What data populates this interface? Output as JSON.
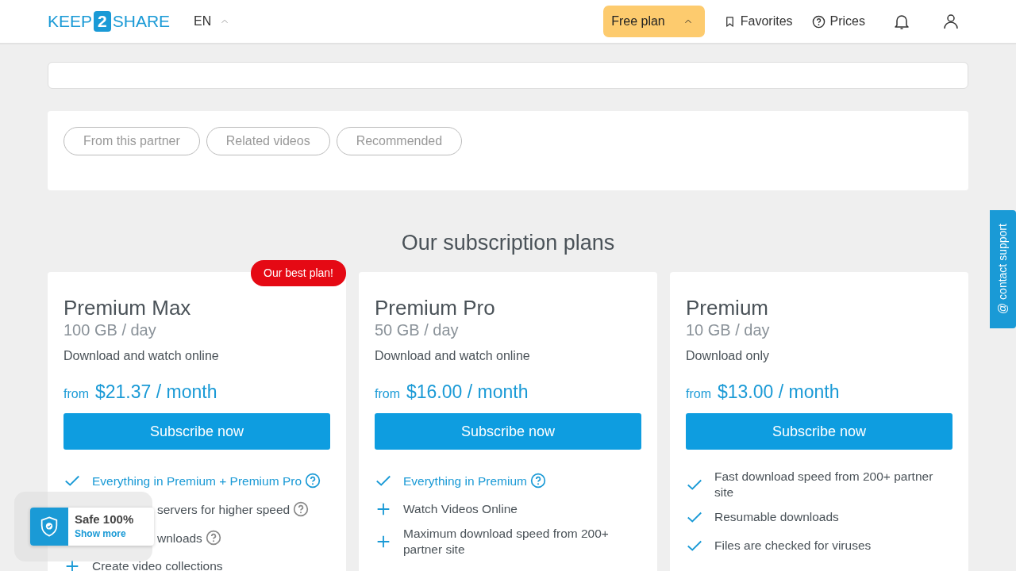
{
  "header": {
    "logo": {
      "left": "KEEP",
      "badge": "2",
      "right": "SHARE"
    },
    "language": "EN",
    "plan_button": "Free plan",
    "nav": [
      {
        "label": "Favorites"
      },
      {
        "label": "Prices"
      }
    ]
  },
  "tabs": [
    {
      "label": "From this partner",
      "selected": false
    },
    {
      "label": "Related videos",
      "selected": false
    },
    {
      "label": "Recommended",
      "selected": false
    }
  ],
  "plans_title": "Our subscription plans",
  "plans": [
    {
      "badge": "Our best plan!",
      "name": "Premium Max",
      "quota": "100 GB / day",
      "description": "Download and watch online",
      "from": "from",
      "price": "$21.37 / month",
      "button": "Subscribe now",
      "features": [
        {
          "kind": "check",
          "text": "Everything in Premium + Premium Pro",
          "emphasis": true,
          "help": true
        },
        {
          "kind": "covered",
          "text": "servers for higher speed",
          "emphasis": false,
          "help": true
        },
        {
          "kind": "covered",
          "text": "wnloads",
          "emphasis": false,
          "help": true
        },
        {
          "kind": "plus",
          "text": "Create video collections",
          "emphasis": false,
          "help": false
        }
      ]
    },
    {
      "name": "Premium Pro",
      "quota": "50 GB / day",
      "description": "Download and watch online",
      "from": "from",
      "price": "$16.00 / month",
      "button": "Subscribe now",
      "features": [
        {
          "kind": "check",
          "text": "Everything in Premium",
          "emphasis": true,
          "help": true
        },
        {
          "kind": "plus",
          "text": "Watch Videos Online",
          "emphasis": false,
          "help": false
        },
        {
          "kind": "plus",
          "text": "Maximum download speed from 200+ partner site",
          "emphasis": false,
          "help": false
        }
      ]
    },
    {
      "name": "Premium",
      "quota": "10 GB / day",
      "description": "Download only",
      "from": "from",
      "price": "$13.00 / month",
      "button": "Subscribe now",
      "features": [
        {
          "kind": "check",
          "text": "Fast download speed from 200+ partner site",
          "emphasis": false,
          "help": false
        },
        {
          "kind": "check",
          "text": "Resumable downloads",
          "emphasis": false,
          "help": false
        },
        {
          "kind": "check",
          "text": "Files are checked for viruses",
          "emphasis": false,
          "help": false
        }
      ]
    }
  ],
  "safe_widget": {
    "title": "Safe 100%",
    "link": "Show more"
  },
  "contact_tab": "@ contact support"
}
